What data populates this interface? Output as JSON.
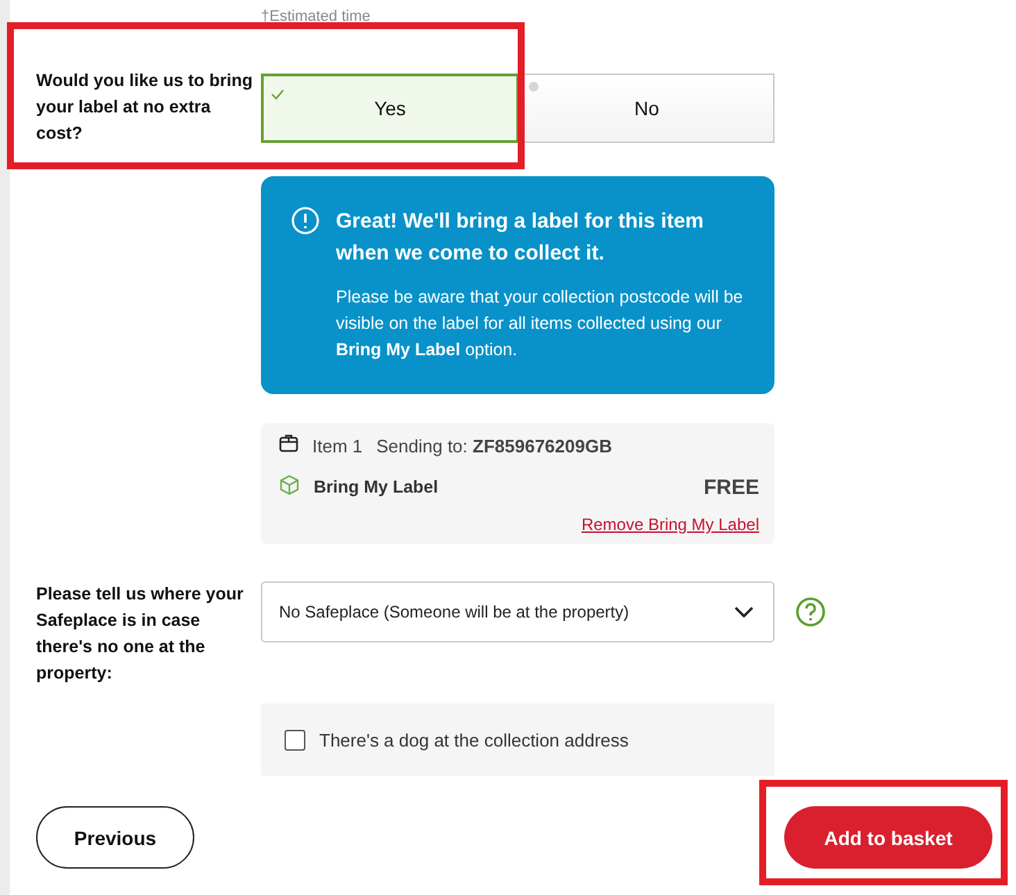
{
  "estimate_note": "†Estimated time",
  "question": {
    "label": "Would you like us to bring your label at no extra cost?",
    "highlighted": true,
    "options": [
      {
        "label": "Yes",
        "selected": true
      },
      {
        "label": "No",
        "selected": false
      }
    ]
  },
  "info": {
    "title": "Great! We'll bring a label for this item when we come to collect it.",
    "body": "Please be aware that your collection postcode will be visible on the label for all items collected using our **Bring My Label** option."
  },
  "item": {
    "name": "Item 1",
    "sending_to": "Sending to: **ZF859676209GB**",
    "service": "Bring My Label",
    "price": "FREE",
    "remove_link": "Remove Bring My Label"
  },
  "safeplace": {
    "label": "Please tell us where your Safeplace is in case there's no one at the property:",
    "value": "No Safeplace (Someone will be at the property)"
  },
  "dog": {
    "label": "There's a dog at the collection address",
    "checked": false
  },
  "buttons": [
    {
      "label": "Previous",
      "kind": "secondary"
    },
    {
      "label": "Add to basket",
      "kind": "primary",
      "highlighted": true
    }
  ]
}
